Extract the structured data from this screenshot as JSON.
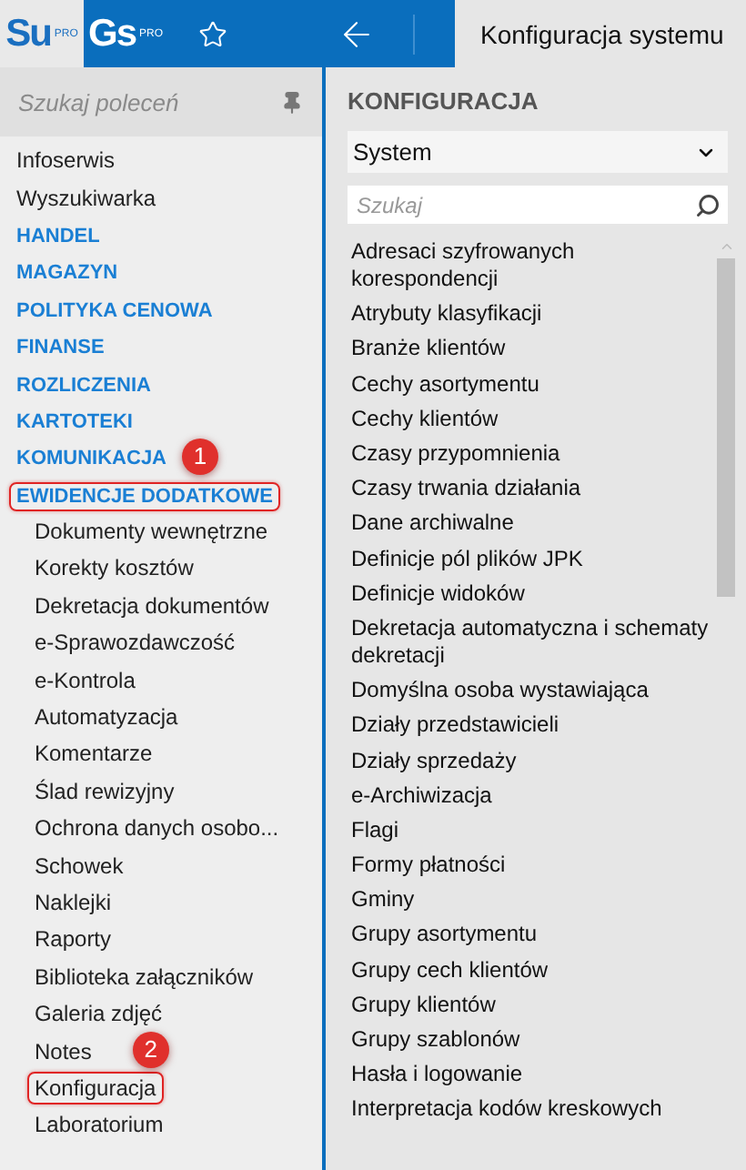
{
  "header": {
    "apps": [
      {
        "label": "Su",
        "sup": "PRO",
        "selected": false
      },
      {
        "label": "Gs",
        "sup": "PRO",
        "selected": true
      }
    ],
    "title": "Konfiguracja systemu"
  },
  "sidebar": {
    "search": {
      "placeholder": "Szukaj poleceń"
    },
    "items": [
      {
        "label": "Infoserwis",
        "kind": "link",
        "highlighted": false
      },
      {
        "label": "Wyszukiwarka",
        "kind": "link",
        "highlighted": false
      },
      {
        "label": "HANDEL",
        "kind": "section",
        "highlighted": false
      },
      {
        "label": "MAGAZYN",
        "kind": "section",
        "highlighted": false
      },
      {
        "label": "POLITYKA CENOWA",
        "kind": "section",
        "highlighted": false
      },
      {
        "label": "FINANSE",
        "kind": "section",
        "highlighted": false
      },
      {
        "label": "ROZLICZENIA",
        "kind": "section",
        "highlighted": false
      },
      {
        "label": "KARTOTEKI",
        "kind": "section",
        "highlighted": false
      },
      {
        "label": "KOMUNIKACJA",
        "kind": "section",
        "highlighted": false
      },
      {
        "label": "EWIDENCJE DODATKOWE",
        "kind": "section",
        "highlighted": true,
        "badge": "1",
        "children": [
          {
            "label": "Dokumenty wewnętrzne",
            "kind": "link",
            "highlighted": false
          },
          {
            "label": "Korekty kosztów",
            "kind": "link",
            "highlighted": false
          },
          {
            "label": "Dekretacja dokumentów",
            "kind": "link",
            "highlighted": false
          },
          {
            "label": "e-Sprawozdawczość",
            "kind": "link",
            "highlighted": false
          },
          {
            "label": "e-Kontrola",
            "kind": "link",
            "highlighted": false
          },
          {
            "label": "Automatyzacja",
            "kind": "link",
            "highlighted": false
          },
          {
            "label": "Komentarze",
            "kind": "link",
            "highlighted": false
          },
          {
            "label": "Ślad rewizyjny",
            "kind": "link",
            "highlighted": false
          },
          {
            "label": "Ochrona danych osobo...",
            "kind": "link",
            "highlighted": false
          },
          {
            "label": "Schowek",
            "kind": "link",
            "highlighted": false
          },
          {
            "label": "Naklejki",
            "kind": "link",
            "highlighted": false
          },
          {
            "label": "Raporty",
            "kind": "link",
            "highlighted": false
          },
          {
            "label": "Biblioteka załączników",
            "kind": "link",
            "highlighted": false
          },
          {
            "label": "Galeria zdjęć",
            "kind": "link",
            "highlighted": false
          },
          {
            "label": "Notes",
            "kind": "link",
            "highlighted": false
          },
          {
            "label": "Konfiguracja",
            "kind": "link",
            "highlighted": true,
            "badge": "2"
          },
          {
            "label": "Laboratorium",
            "kind": "link",
            "highlighted": false
          }
        ]
      }
    ]
  },
  "content": {
    "heading": "KONFIGURACJA",
    "select": {
      "value": "System"
    },
    "search": {
      "placeholder": "Szukaj"
    },
    "items": [
      "Adresaci szyfrowanych korespondencji",
      "Atrybuty klasyfikacji",
      "Branże klientów",
      "Cechy asortymentu",
      "Cechy klientów",
      "Czasy przypomnienia",
      "Czasy trwania działania",
      "Dane archiwalne",
      "Definicje pól plików JPK",
      "Definicje widoków",
      "Dekretacja automatyczna i schematy dekretacji",
      "Domyślna osoba wystawiająca",
      "Działy przedstawicieli",
      "Działy sprzedaży",
      "e-Archiwizacja",
      "Flagi",
      "Formy płatności",
      "Gminy",
      "Grupy asortymentu",
      "Grupy cech klientów",
      "Grupy klientów",
      "Grupy szablonów",
      "Hasła i logowanie",
      "Interpretacja kodów kreskowych"
    ]
  }
}
